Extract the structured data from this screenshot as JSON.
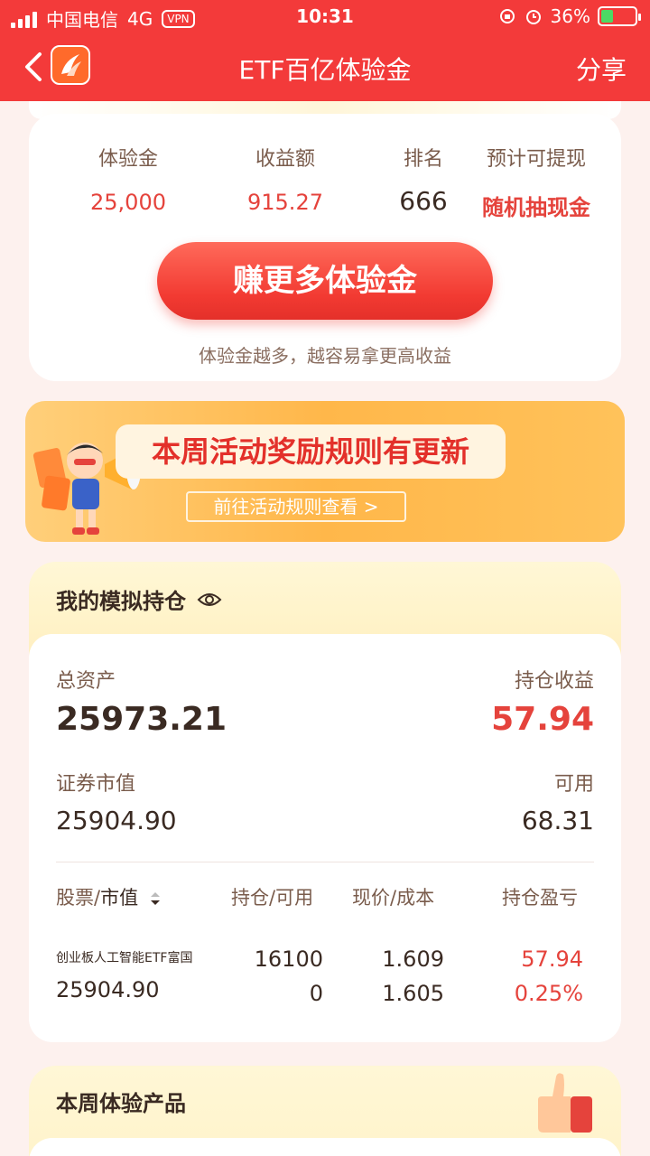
{
  "status": {
    "carrier": "中国电信",
    "network": "4G",
    "vpn": "VPN",
    "time": "10:31",
    "battery": "36%",
    "battery_level": 0.36
  },
  "nav": {
    "title": "ETF百亿体验金",
    "share": "分享"
  },
  "summary": {
    "items": [
      {
        "label": "体验金",
        "value": "25,000"
      },
      {
        "label": "收益额",
        "value": "915.27"
      },
      {
        "label": "排名",
        "value": "666"
      },
      {
        "label": "预计可提现",
        "value": "随机抽现金"
      }
    ],
    "button": "赚更多体验金",
    "hint": "体验金越多，越容易拿更高收益"
  },
  "banner": {
    "title": "本周活动奖励规则有更新",
    "link": "前往活动规则查看 >"
  },
  "holdings": {
    "title": "我的模拟持仓",
    "total_assets_label": "总资产",
    "total_assets": "25973.21",
    "position_profit_label": "持仓收益",
    "position_profit": "57.94",
    "market_value_label": "证券市值",
    "market_value": "25904.90",
    "available_label": "可用",
    "available": "68.31",
    "columns": {
      "stock": "股票/",
      "market": "市值",
      "hold": "持仓/可用",
      "price": "现价/成本",
      "pnl": "持仓盈亏"
    },
    "rows": [
      {
        "name": "创业板人工智能ETF富国",
        "market_value": "25904.90",
        "hold": "16100",
        "available": "0",
        "price": "1.609",
        "cost": "1.605",
        "pnl": "57.94",
        "pnl_pct": "0.25%"
      }
    ]
  },
  "weekly": {
    "title": "本周体验产品"
  },
  "colors": {
    "brand_red": "#f33a3a",
    "profit_red": "#e5433c",
    "gold": "#ffb74a"
  }
}
